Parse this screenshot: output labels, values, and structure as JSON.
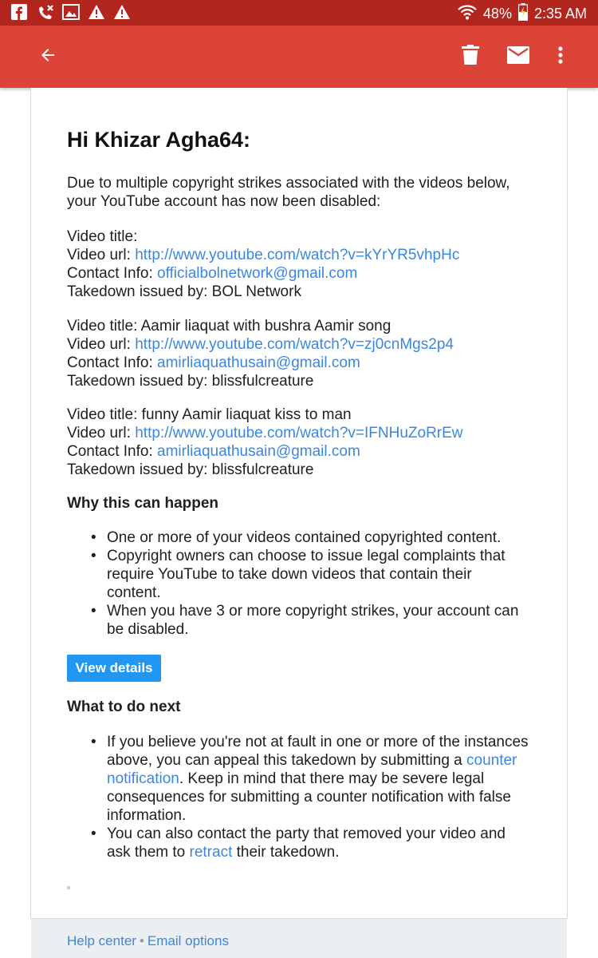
{
  "status_bar": {
    "battery": "48%",
    "time": "2:35 AM",
    "icons": [
      "facebook-icon",
      "missed-call-icon",
      "image-icon",
      "warning-icon",
      "warning-icon",
      "wifi-icon",
      "battery-charging-icon"
    ]
  },
  "toolbar": {
    "icons": [
      "back-arrow-icon",
      "delete-icon",
      "mark-unread-icon",
      "more-vert-icon"
    ],
    "color": "#db4437"
  },
  "email": {
    "greeting": "Hi Khizar Agha64:",
    "intro": "Due to multiple copyright strikes associated with the videos below, your YouTube account has now been disabled:",
    "labels": {
      "title": "Video title:",
      "url": "Video url:",
      "contact": "Contact Info:",
      "takedown": "Takedown issued by:"
    },
    "strikes": [
      {
        "title": "",
        "url": "http://www.youtube.com/watch?v=kYrYR5vhpHc",
        "contact": "officialbolnetwork@gmail.com",
        "issuer": "BOL Network"
      },
      {
        "title": "Aamir liaquat with bushra Aamir song",
        "url": "http://www.youtube.com/watch?v=zj0cnMgs2p4",
        "contact": "amirliaquathusain@gmail.com",
        "issuer": "blissfulcreature"
      },
      {
        "title": "funny Aamir liaquat kiss to man",
        "url": "http://www.youtube.com/watch?v=IFNHuZoRrEw",
        "contact": "amirliaquathusain@gmail.com",
        "issuer": "blissfulcreature"
      }
    ],
    "why_heading": "Why this can happen",
    "why_items": [
      "One or more of your videos contained copyrighted content.",
      "Copyright owners can choose to issue legal complaints that require YouTube to take down videos that contain their content.",
      "When you have 3 or more copyright strikes, your account can be disabled."
    ],
    "view_details": "View details",
    "next_heading": "What to do next",
    "next_item1": {
      "before": "If you believe you're not at fault in one or more of the instances above, you can appeal this takedown by submitting a ",
      "link": "counter notification",
      "after": ". Keep in mind that there may be severe legal consequences for submitting a counter notification with false information."
    },
    "next_item2": {
      "before": "You can also contact the party that removed your video and ask them to ",
      "link": "retract",
      "after": " their takedown."
    }
  },
  "footer": {
    "help": "Help center",
    "separator": "•",
    "email_options": "Email options"
  }
}
